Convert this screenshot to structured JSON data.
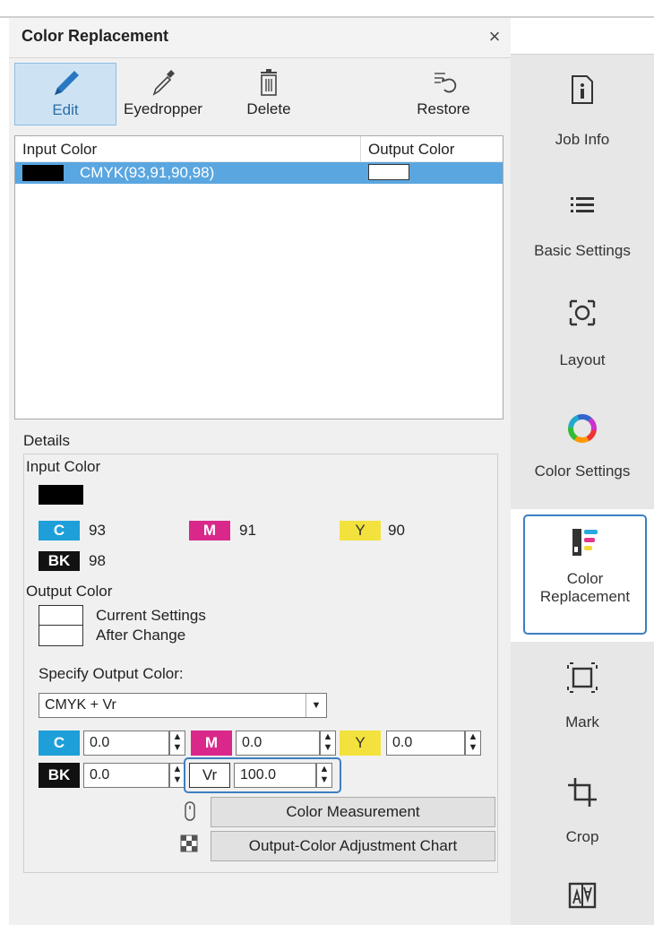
{
  "panel": {
    "title": "Color Replacement",
    "close_icon": "×"
  },
  "toolbar": {
    "edit": "Edit",
    "eyedropper": "Eyedropper",
    "delete": "Delete",
    "restore": "Restore"
  },
  "list": {
    "header_input": "Input Color",
    "header_output": "Output Color",
    "rows": [
      {
        "input": "CMYK(93,91,90,98)"
      }
    ]
  },
  "details": {
    "label": "Details",
    "input_color_label": "Input Color",
    "c_label": "C",
    "c_value": "93",
    "m_label": "M",
    "m_value": "91",
    "y_label": "Y",
    "y_value": "90",
    "bk_label": "BK",
    "bk_value": "98",
    "output_color_label": "Output Color",
    "current_settings": "Current Settings",
    "after_change": "After Change",
    "specify_label": "Specify Output Color:",
    "mode_selected": "CMYK + Vr",
    "fields": {
      "c_label": "C",
      "c_value": "0.0",
      "m_label": "M",
      "m_value": "0.0",
      "y_label": "Y",
      "y_value": "0.0",
      "bk_label": "BK",
      "bk_value": "0.0",
      "vr_label": "Vr",
      "vr_value": "100.0"
    },
    "color_measurement": "Color Measurement",
    "adjustment_chart": "Output-Color Adjustment Chart"
  },
  "sidebar": {
    "job_info": "Job Info",
    "basic_settings": "Basic Settings",
    "layout": "Layout",
    "color_settings": "Color Settings",
    "color_replacement_1": "Color",
    "color_replacement_2": "Replacement",
    "mark": "Mark",
    "crop": "Crop"
  },
  "colors": {
    "accent": "#3d7fc1",
    "selected_row": "#5aa6e0",
    "cyan": "#1e9fd9",
    "magenta": "#d9288a",
    "yellow": "#f3e23d"
  }
}
